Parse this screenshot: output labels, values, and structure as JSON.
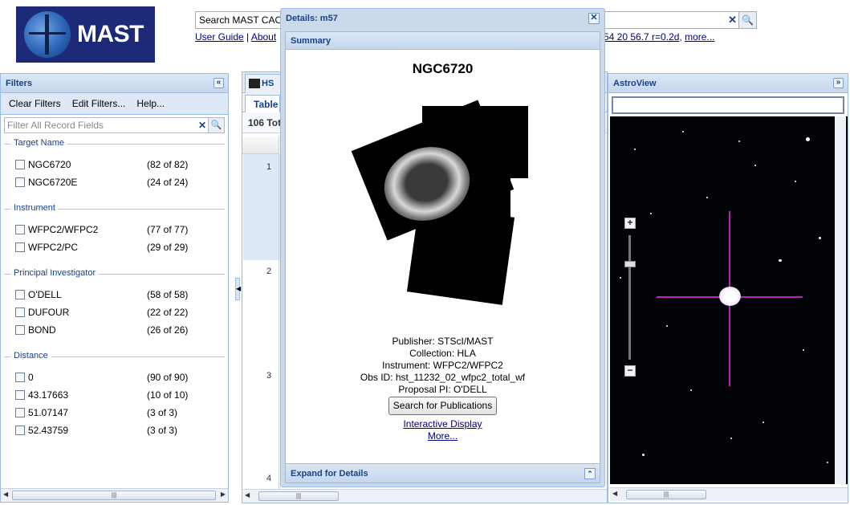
{
  "header": {
    "logo_text": "MAST",
    "search_value": "Search MAST CAO",
    "links": {
      "user_guide": "User Guide",
      "sep": " | ",
      "about": "About"
    },
    "coord_text": "54 20 56.7 r=0.2d",
    "more_link": "more..."
  },
  "filters": {
    "title": "Filters",
    "toolbar": [
      "Clear Filters",
      "Edit Filters...",
      "Help..."
    ],
    "search_placeholder": "Filter All Record Fields",
    "groups": [
      {
        "title": "Target Name",
        "items": [
          {
            "label": "NGC6720",
            "count": "(82 of 82)"
          },
          {
            "label": "NGC6720E",
            "count": "(24 of 24)"
          }
        ]
      },
      {
        "title": "Instrument",
        "items": [
          {
            "label": "WFPC2/WFPC2",
            "count": "(77 of 77)"
          },
          {
            "label": "WFPC2/PC",
            "count": "(29 of 29)"
          }
        ]
      },
      {
        "title": "Principal Investigator",
        "items": [
          {
            "label": "O'DELL",
            "count": "(58 of 58)"
          },
          {
            "label": "DUFOUR",
            "count": "(22 of 22)"
          },
          {
            "label": "BOND",
            "count": "(26 of 26)"
          }
        ]
      },
      {
        "title": "Distance",
        "items": [
          {
            "label": "0",
            "count": "(90 of 90)"
          },
          {
            "label": "43.17663",
            "count": "(10 of 10)"
          },
          {
            "label": "51.07147",
            "count": "(3 of 3)"
          },
          {
            "label": "52.43759",
            "count": "(3 of 3)"
          }
        ]
      }
    ]
  },
  "grid": {
    "tab_label": "HS",
    "subtab_label": "Table",
    "total_label": "106 Tot",
    "row_numbers": [
      "1",
      "2",
      "3",
      "4"
    ]
  },
  "details": {
    "title": "Details: m57",
    "summary_header": "Summary",
    "object_name": "NGC6720",
    "publisher": "Publisher: STScI/MAST",
    "collection": "Collection: HLA",
    "instrument": "Instrument: WFPC2/WFPC2",
    "obs_id": "Obs ID: hst_11232_02_wfpc2_total_wf",
    "proposal_pi": "Proposal PI: O'DELL",
    "search_pubs_button": "Search for Publications",
    "interactive_link": "Interactive Display",
    "more_link": "More...",
    "expand_header": "Expand for Details"
  },
  "astroview": {
    "title": "AstroView",
    "crosshair_color": "#c020c0"
  },
  "icons": {
    "collapse_left": "«",
    "collapse_right": "»",
    "close": "✕",
    "clear": "✕",
    "search": "🔍",
    "expand_up": "⌃",
    "zoom_in": "+",
    "zoom_out": "−",
    "scroll_left": "◀",
    "scroll_right": "▶",
    "splitter": "◀",
    "grip": "|||"
  }
}
